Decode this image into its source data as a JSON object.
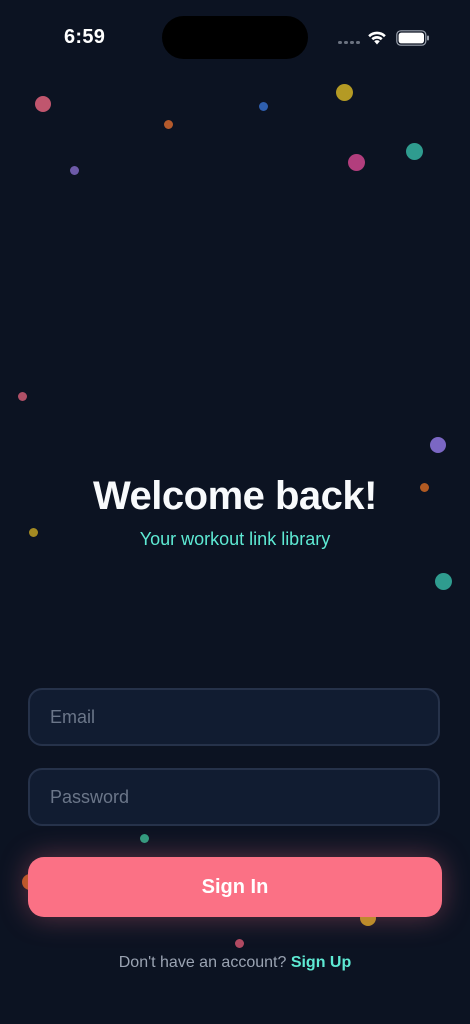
{
  "status_bar": {
    "time": "6:59"
  },
  "hero": {
    "title": "Welcome back!",
    "subtitle": "Your workout link library"
  },
  "form": {
    "email_placeholder": "Email",
    "password_placeholder": "Password",
    "submit_label": "Sign In"
  },
  "footer": {
    "prompt": "Don't have an account?",
    "link_label": "Sign Up"
  },
  "colors": {
    "background": "#0c1322",
    "accent": "#fb7185",
    "secondary": "#5eead4"
  }
}
